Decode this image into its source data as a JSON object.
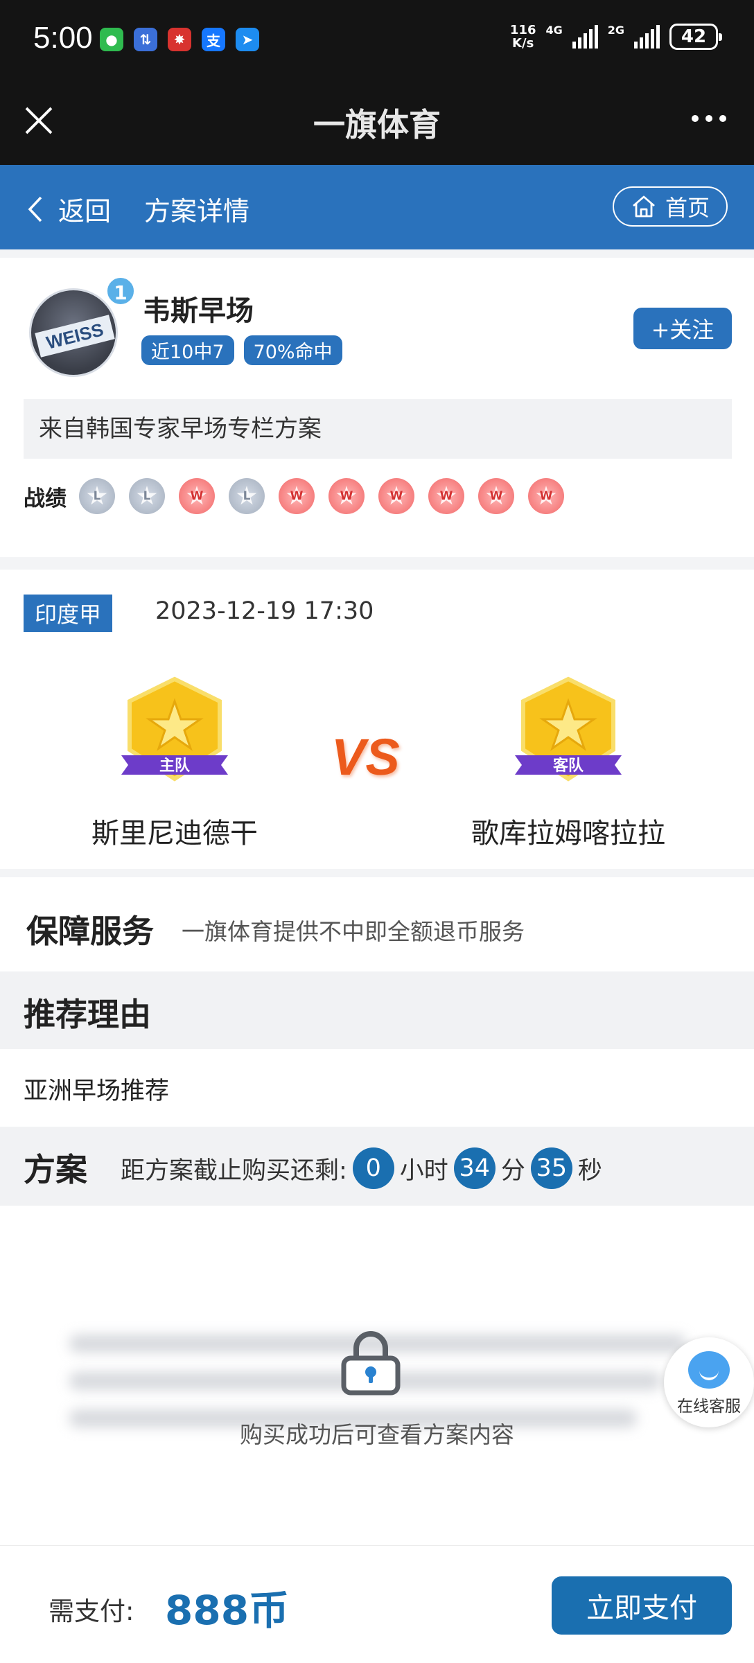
{
  "status_bar": {
    "time": "5:00",
    "net_speed_value": "116",
    "net_speed_unit": "K/s",
    "sim1_label": "4G",
    "sim2_label": "2G",
    "battery": "42"
  },
  "app": {
    "title": "一旗体育"
  },
  "nav": {
    "back_label": "返回",
    "title": "方案详情",
    "home_label": "首页"
  },
  "expert": {
    "name": "韦斯早场",
    "rank": "1",
    "avatar_text": "WEISS",
    "tags": [
      "近10中7",
      "70%命中"
    ],
    "follow_label": "+关注",
    "description": "来自韩国专家早场专栏方案",
    "record_label": "战绩",
    "record": [
      "L",
      "L",
      "W",
      "L",
      "W",
      "W",
      "W",
      "W",
      "W",
      "W"
    ]
  },
  "match": {
    "league": "印度甲",
    "datetime": "2023-12-19 17:30",
    "home_badge": "主队",
    "away_badge": "客队",
    "home_team": "斯里尼迪德干",
    "away_team": "歌库拉姆喀拉拉",
    "vs": "VS"
  },
  "guarantee": {
    "title": "保障服务",
    "text": "一旗体育提供不中即全额退币服务"
  },
  "reason": {
    "title": "推荐理由",
    "text": "亚洲早场推荐"
  },
  "plan": {
    "title": "方案",
    "countdown_label": "距方案截止购买还剩:",
    "hours": "0",
    "hours_unit": "小时",
    "minutes": "34",
    "minutes_unit": "分",
    "seconds": "35",
    "seconds_unit": "秒",
    "locked_text": "购买成功后可查看方案内容"
  },
  "customer_service": {
    "label": "在线客服"
  },
  "payment": {
    "label": "需支付:",
    "amount": "888币",
    "button": "立即支付"
  },
  "colors": {
    "primary": "#2a72bc",
    "primary_dark": "#1a6fb0",
    "vs": "#ec5a1c",
    "win": "#f26767",
    "loss": "#a3aebd"
  }
}
